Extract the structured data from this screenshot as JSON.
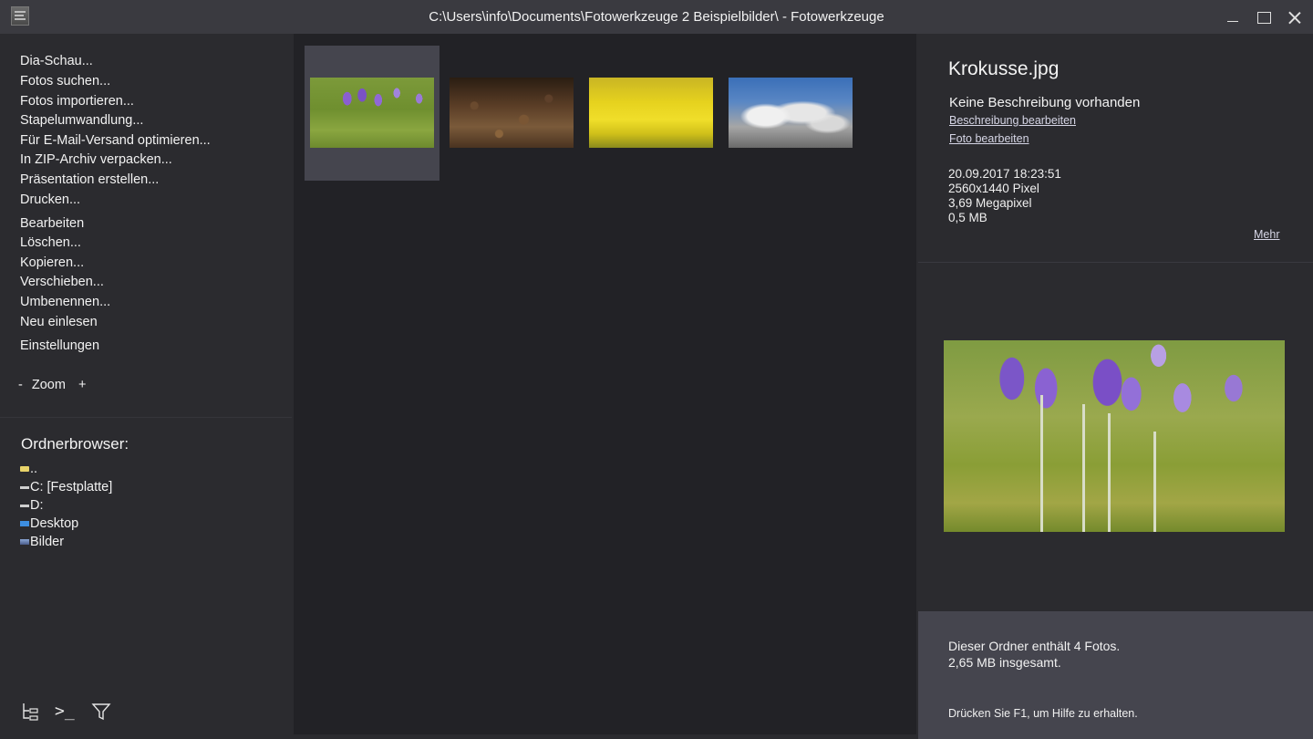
{
  "window": {
    "title": "C:\\Users\\info\\Documents\\Fotowerkzeuge 2 Beispielbilder\\ - Fotowerkzeuge",
    "app_icon": "fotowerkzeuge-logo-icon"
  },
  "menu": {
    "items": [
      "Dia-Schau...",
      "Fotos suchen...",
      "Fotos importieren...",
      "Stapelumwandlung...",
      "Für E-Mail-Versand optimieren...",
      "In ZIP-Archiv verpacken...",
      "Präsentation erstellen...",
      "Drucken...",
      "Bearbeiten",
      "Löschen...",
      "Kopieren...",
      "Verschieben...",
      "Umbenennen...",
      "Neu einlesen",
      "Einstellungen"
    ],
    "zoom": {
      "minus": "-",
      "label": "Zoom",
      "plus": "+"
    }
  },
  "folder_browser": {
    "title": "Ordnerbrowser:",
    "items": [
      {
        "label": "..",
        "icon": "folder-icon"
      },
      {
        "label": "C: [Festplatte]",
        "icon": "drive-icon"
      },
      {
        "label": "D:",
        "icon": "drive-icon"
      },
      {
        "label": "Desktop",
        "icon": "desktop-icon"
      },
      {
        "label": "Bilder",
        "icon": "pictures-icon"
      }
    ]
  },
  "bottom_icons": {
    "tree": "⌞",
    "console": ">_",
    "filter": "⊽"
  },
  "thumbnails": [
    {
      "name": "crocus",
      "selected": true
    },
    {
      "name": "leaves",
      "selected": false
    },
    {
      "name": "rapeseed",
      "selected": false
    },
    {
      "name": "sky",
      "selected": false
    }
  ],
  "details": {
    "filename": "Krokusse.jpg",
    "description": "Keine Beschreibung vorhanden",
    "edit_description": "Beschreibung bearbeiten",
    "edit_photo": "Foto bearbeiten",
    "date": "20.09.2017 18:23:51",
    "dimensions": "2560x1440 Pixel",
    "megapixel": "3,69 Megapixel",
    "size": "0,5 MB",
    "more": "Mehr"
  },
  "footer": {
    "count": "Dieser Ordner enthält 4 Fotos.",
    "total": "2,65 MB insgesamt.",
    "help": "Drücken Sie F1, um Hilfe zu erhalten."
  }
}
